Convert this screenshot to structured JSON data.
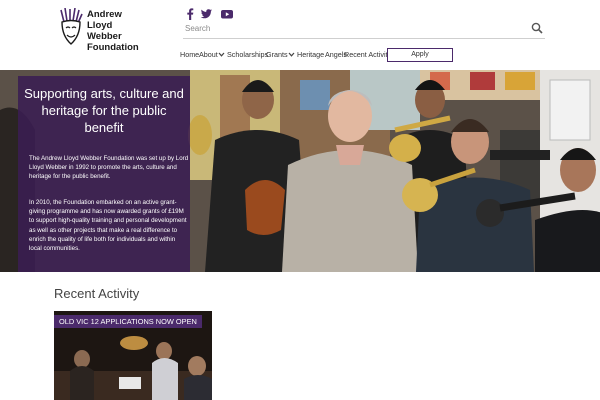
{
  "header": {
    "logo_lines": [
      "Andrew",
      "Lloyd",
      "Webber",
      "Foundation"
    ],
    "social_icons": [
      "facebook-icon",
      "twitter-icon",
      "youtube-icon"
    ],
    "search_placeholder": "Search",
    "nav": [
      {
        "label": "Home",
        "has_menu": false
      },
      {
        "label": "About",
        "has_menu": true
      },
      {
        "label": "Scholarships",
        "has_menu": false
      },
      {
        "label": "Grants",
        "has_menu": true
      },
      {
        "label": "Heritage",
        "has_menu": false
      },
      {
        "label": "Angels",
        "has_menu": false
      },
      {
        "label": "Recent Activity",
        "has_menu": false
      }
    ],
    "apply_label": "Apply"
  },
  "hero": {
    "title": "Supporting arts, culture and heritage for the public benefit",
    "paragraph1": "The Andrew Lloyd Webber Foundation was set up by Lord Lloyd Webber in 1992 to promote the arts, culture and heritage for the public benefit.",
    "paragraph2": "In 2010, the Foundation embarked on an active grant-giving programme and has now awarded grants of £19M to support high-quality training and personal development as well as other projects that make a real difference to enrich the quality of life both for individuals and within local communities."
  },
  "recent": {
    "heading": "Recent Activity",
    "cards": [
      {
        "label": "OLD VIC 12 APPLICATIONS NOW OPEN"
      }
    ]
  },
  "colors": {
    "brand_purple": "#4b2a6b",
    "panel_purple": "#3a1e52",
    "icon_purple": "#4b2a6b",
    "text": "#333333"
  }
}
